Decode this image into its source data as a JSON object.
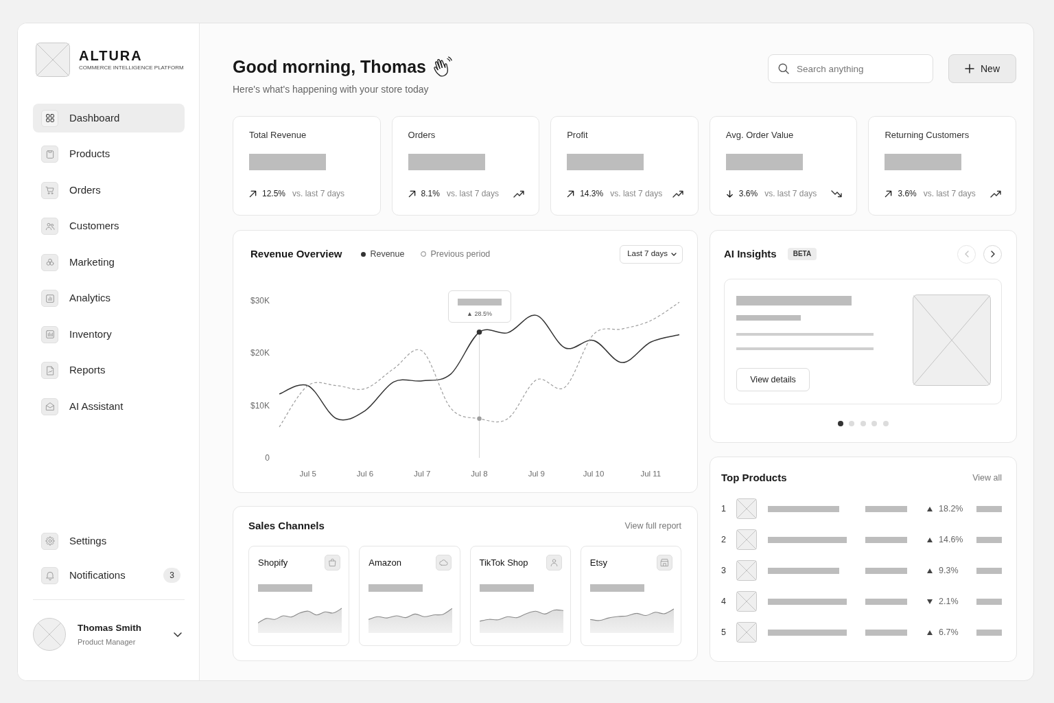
{
  "sidebar": {
    "brand": {
      "name": "ALTURA",
      "tagline": "COMMERCE INTELLIGENCE PLATFORM"
    },
    "nav_items": [
      {
        "label": "Dashboard",
        "selected": true
      },
      {
        "label": "Products",
        "selected": false
      },
      {
        "label": "Orders",
        "selected": false
      },
      {
        "label": "Customers",
        "selected": false
      },
      {
        "label": "Marketing",
        "selected": false
      },
      {
        "label": "Analytics",
        "selected": false
      },
      {
        "label": "Inventory",
        "selected": false
      },
      {
        "label": "Reports",
        "selected": false
      },
      {
        "label": "AI Assistant",
        "selected": false
      }
    ],
    "footer_items": [
      {
        "label": "Settings",
        "selected": false
      },
      {
        "label": "Notifications",
        "selected": false,
        "count": "3"
      }
    ],
    "user": {
      "name": "Thomas Smith",
      "role": "Product Manager"
    }
  },
  "header": {
    "greeting": "Good morning, Thomas",
    "subtitle": "Here's what's happening with your store today",
    "search": {
      "placeholder": "Search anything"
    },
    "new_button": "New"
  },
  "kpi_cards": [
    {
      "label": "Total Revenue",
      "kind": "up",
      "change": "12.5%",
      "comparison": "vs. last 7 days",
      "trend_icon": false
    },
    {
      "label": "Orders",
      "kind": "up",
      "change": "8.1%",
      "comparison": "vs. last 7 days",
      "trend_icon": true
    },
    {
      "label": "Profit",
      "kind": "up",
      "change": "14.3%",
      "comparison": "vs. last 7 days",
      "trend_icon": true
    },
    {
      "label": "Avg. Order Value",
      "kind": "down",
      "change": "3.6%",
      "comparison": "vs. last 7 days",
      "trend_icon": true
    },
    {
      "label": "Returning Customers",
      "kind": "up",
      "change": "3.6%",
      "comparison": "vs. last 7 days",
      "trend_icon": true
    }
  ],
  "revenue_overview": {
    "title": "Revenue Overview",
    "range": "Last 7 days",
    "chart_data": {
      "type": "line",
      "categories": [
        null,
        "Jul 5",
        null,
        "Jul 6",
        null,
        "Jul 7",
        null,
        "Jul 8",
        null,
        "Jul 9",
        null,
        "Jul 10",
        null,
        "Jul 11",
        null
      ],
      "ylim": [
        0,
        30000
      ],
      "yticks": [
        {
          "value": 0,
          "label": "0"
        },
        {
          "value": 10000,
          "label": "$10K"
        },
        {
          "value": 20000,
          "label": "$20K"
        },
        {
          "value": 30000,
          "label": "$30K"
        }
      ],
      "series": [
        {
          "name": "Revenue",
          "color": "#333333",
          "line_style": "solid",
          "values": [
            12200,
            13800,
            7500,
            9000,
            14500,
            14700,
            16000,
            24000,
            23900,
            27200,
            21000,
            22400,
            18200,
            22100,
            23500
          ]
        },
        {
          "name": "Previous period",
          "color": "#9e9e9e",
          "line_style": "dashed",
          "values": [
            5900,
            13800,
            13800,
            13200,
            17000,
            20400,
            9500,
            7500,
            7500,
            14900,
            13500,
            23600,
            24600,
            26200,
            29700
          ]
        }
      ],
      "annotations": [
        {
          "x": "Jul 8",
          "y": 24000,
          "text": "▲ 28.5%"
        }
      ]
    }
  },
  "ai_insights": {
    "title": "AI Insights",
    "badge": "BETA",
    "nav_buttons": [
      {
        "kind": "prev",
        "disabled": true
      },
      {
        "kind": "next",
        "disabled": false
      }
    ],
    "action": "View details",
    "pages": [
      {
        "selected": true
      },
      {
        "selected": false
      },
      {
        "selected": false
      },
      {
        "selected": false
      },
      {
        "selected": false
      }
    ]
  },
  "sales_channels": {
    "title": "Sales Channels",
    "link": "View full report",
    "channels": [
      {
        "name": "Shopify"
      },
      {
        "name": "Amazon"
      },
      {
        "name": "TikTok Shop"
      },
      {
        "name": "Etsy"
      }
    ]
  },
  "top_products": {
    "title": "Top Products",
    "link": "View all",
    "rows": [
      {
        "rank": "1",
        "kind": "up",
        "change": "18.2%"
      },
      {
        "rank": "2",
        "kind": "up",
        "change": "14.6%"
      },
      {
        "rank": "3",
        "kind": "up",
        "change": "9.3%"
      },
      {
        "rank": "4",
        "kind": "down",
        "change": "2.1%"
      },
      {
        "rank": "5",
        "kind": "up",
        "change": "6.7%"
      }
    ]
  }
}
